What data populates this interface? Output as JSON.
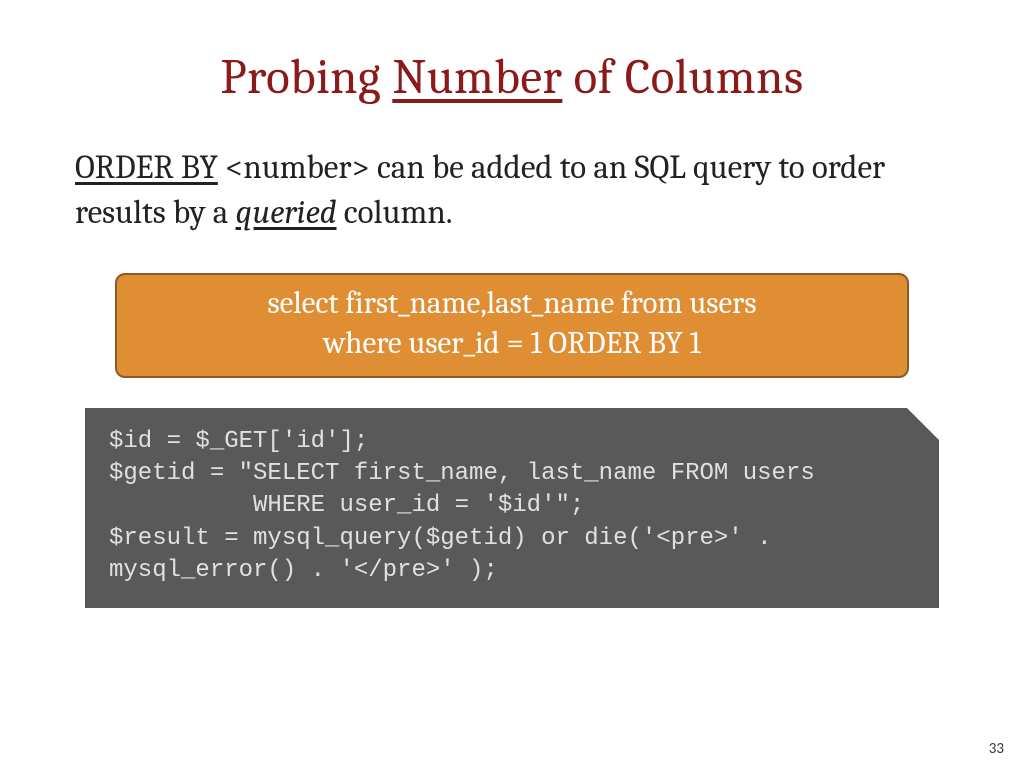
{
  "title": {
    "part1": "Probing ",
    "underlined": "Number",
    "part2": " of Columns"
  },
  "description": {
    "underline1": "ORDER BY",
    "mid1": " <number> can be added to an SQL query to order results by a ",
    "italic_underline": "queried",
    "tail": " column."
  },
  "sql_box": {
    "line1": "select first_name,last_name from users",
    "line2": "where user_id = 1 ORDER BY 1"
  },
  "code_box": "$id = $_GET['id'];\n$getid = \"SELECT first_name, last_name FROM users\n          WHERE user_id = '$id'\";\n$result = mysql_query($getid) or die('<pre>' .\nmysql_error() . '</pre>' );",
  "page_number": "33"
}
